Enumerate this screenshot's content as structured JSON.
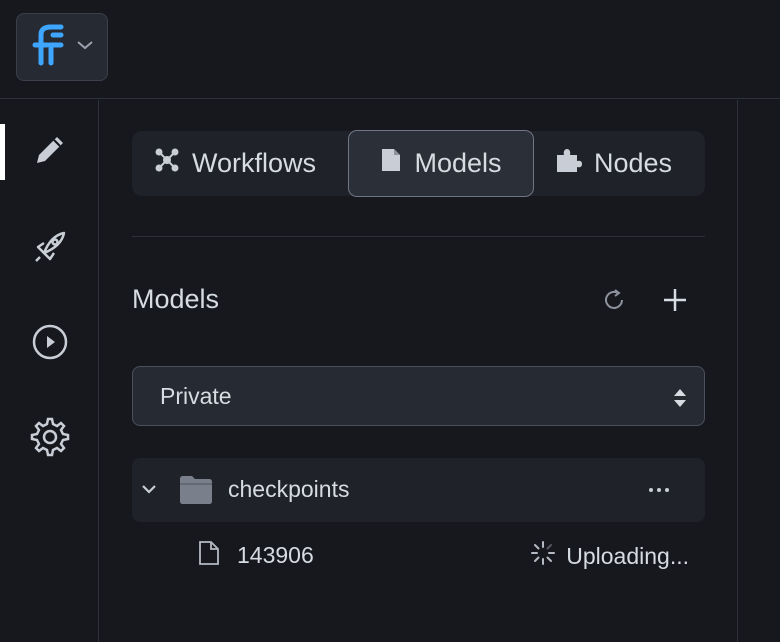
{
  "app": {
    "logo_icon": "flowise-logo-icon",
    "logo_dropdown_icon": "chevron-down-icon",
    "accent": "#3ea6ff"
  },
  "rail": {
    "items": [
      {
        "name": "edit",
        "icon": "pencil-icon",
        "active": true
      },
      {
        "name": "deploy",
        "icon": "rocket-icon",
        "active": false
      },
      {
        "name": "run",
        "icon": "play-circle-icon",
        "active": false
      },
      {
        "name": "settings",
        "icon": "gear-icon",
        "active": false
      }
    ]
  },
  "tabs": [
    {
      "label": "Workflows",
      "icon": "workflow-graph-icon",
      "active": false
    },
    {
      "label": "Models",
      "icon": "document-icon",
      "active": true
    },
    {
      "label": "Nodes",
      "icon": "puzzle-icon",
      "active": false
    }
  ],
  "section": {
    "title": "Models",
    "refresh_icon": "refresh-icon",
    "add_icon": "plus-icon"
  },
  "visibility_select": {
    "value": "Private",
    "icon": "sort-arrows-icon"
  },
  "tree": {
    "folder": {
      "label": "checkpoints",
      "icon": "folder-icon",
      "expanded": true,
      "more_icon": "ellipsis-icon"
    },
    "files": [
      {
        "name": "143906",
        "icon": "file-icon",
        "status": "Uploading...",
        "status_icon": "spinner-icon"
      }
    ]
  }
}
